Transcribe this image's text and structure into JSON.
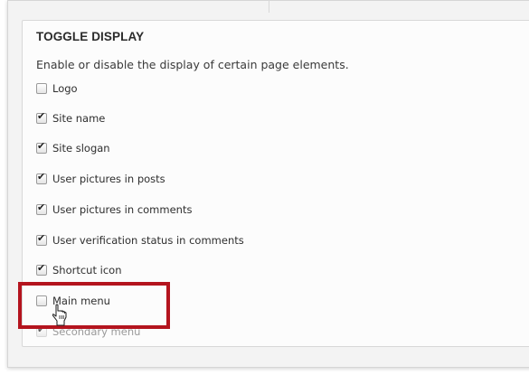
{
  "fieldset": {
    "legend": "TOGGLE DISPLAY",
    "description": "Enable or disable the display of certain page elements."
  },
  "options": [
    {
      "label": "Logo",
      "checked": false
    },
    {
      "label": "Site name",
      "checked": true
    },
    {
      "label": "Site slogan",
      "checked": true
    },
    {
      "label": "User pictures in posts",
      "checked": true
    },
    {
      "label": "User pictures in comments",
      "checked": true
    },
    {
      "label": "User verification status in comments",
      "checked": true
    },
    {
      "label": "Shortcut icon",
      "checked": true
    },
    {
      "label": "Main menu",
      "checked": false
    },
    {
      "label": "Secondary menu",
      "checked": true
    }
  ],
  "colors": {
    "highlight": "#b4141e",
    "text": "#2e2e2e"
  },
  "icons": {
    "cursor": "hand-pointer-icon",
    "check": "checkmark-icon"
  }
}
